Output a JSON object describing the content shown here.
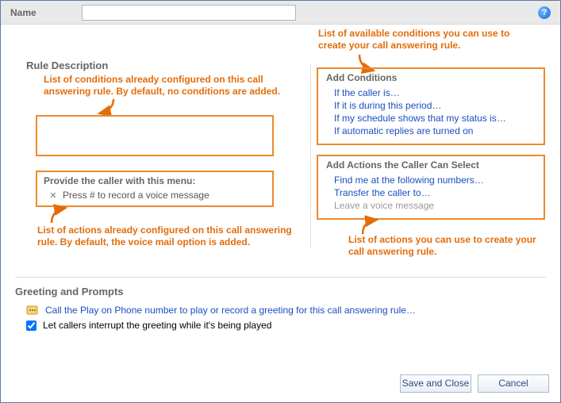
{
  "header": {
    "name_label": "Name",
    "name_value": ""
  },
  "annotations": {
    "right_top": "List of available conditions you can use to create your call answering rule.",
    "left_top": "List of conditions already configured on this call answering rule. By default, no conditions are added.",
    "left_bottom": "List of actions already configured on this call answering rule. By default, the voice mail option is added.",
    "right_bottom": "List of actions you can use to create your call answering rule."
  },
  "left": {
    "section_title": "Rule Description",
    "menu_title": "Provide the caller with this menu:",
    "menu_item": "Press # to record a voice message"
  },
  "right": {
    "conditions_title": "Add Conditions",
    "conditions": [
      "If the caller is…",
      "If it is during this period…",
      "If my schedule shows that my status is…",
      "If automatic replies are turned on"
    ],
    "actions_title": "Add Actions the Caller Can Select",
    "actions": [
      {
        "label": "Find me at the following numbers…",
        "enabled": true
      },
      {
        "label": "Transfer the caller to…",
        "enabled": true
      },
      {
        "label": "Leave a voice message",
        "enabled": false
      }
    ]
  },
  "greeting": {
    "title": "Greeting and Prompts",
    "play_link": "Call the Play on Phone number to play or record a greeting for this call answering rule…",
    "checkbox_label": "Let callers interrupt the greeting while it's being played",
    "checkbox_checked": true
  },
  "footer": {
    "save": "Save and Close",
    "cancel": "Cancel"
  }
}
